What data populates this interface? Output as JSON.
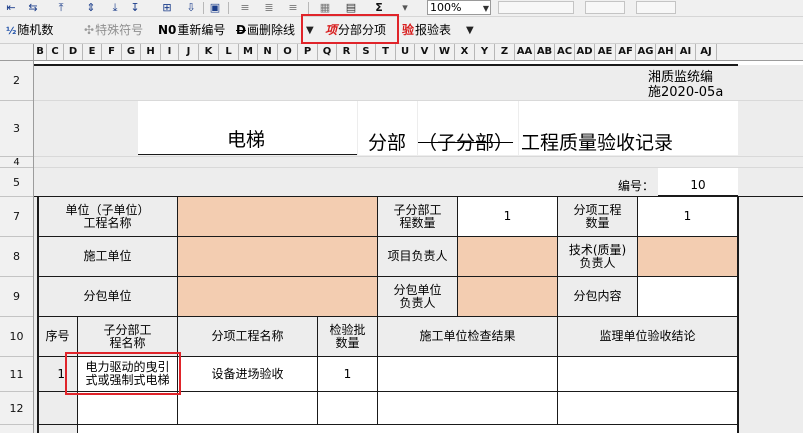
{
  "toolbar_top": {
    "zoom": "100%"
  },
  "toolbar": {
    "random_number": "随机数",
    "special_symbol": "特殊符号",
    "renumber": "重新编号",
    "delete_line": "画删除线",
    "subsection": "分部分项",
    "report_form": "报验表"
  },
  "columns": [
    "B",
    "C",
    "D",
    "E",
    "F",
    "G",
    "H",
    "I",
    "J",
    "K",
    "L",
    "M",
    "N",
    "O",
    "P",
    "Q",
    "R",
    "S",
    "T",
    "U",
    "V",
    "W",
    "X",
    "Y",
    "Z",
    "AA",
    "AB",
    "AC",
    "AD",
    "AE",
    "AF",
    "AG",
    "AH",
    "AI",
    "AJ"
  ],
  "rows": [
    "2",
    "3",
    "4",
    "5",
    "7",
    "8",
    "9",
    "10",
    "11",
    "12"
  ],
  "doc": {
    "code_line1": "湘质监统编",
    "code_line2": "施2020-05a",
    "title_main": "电梯",
    "title_mid": "分部",
    "title_struck": "（子分部）",
    "title_tail": "工程质量验收记录",
    "number_label": "编号：",
    "number_value": "10"
  },
  "info": {
    "unit_label": "单位（子单位）\n工程名称",
    "sub_count_label": "子分部工\n程数量",
    "sub_count_value": "1",
    "item_count_label": "分项工程\n数量",
    "item_count_value": "1",
    "builder_label": "施工单位",
    "project_leader_label": "项目负责人",
    "tech_leader_label": "技术(质量)\n负责人",
    "subcontractor_label": "分包单位",
    "sub_leader_label": "分包单位\n负责人",
    "sub_content_label": "分包内容"
  },
  "table": {
    "headers": [
      "序号",
      "子分部工\n程名称",
      "分项工程名称",
      "检验批\n数量",
      "施工单位检查结果",
      "监理单位验收结论"
    ],
    "rows": [
      {
        "no": "1",
        "subdivision": "电力驱动的曳引\n式或强制式电梯",
        "item": "设备进场验收",
        "count": "1",
        "check": "",
        "conclusion": ""
      }
    ]
  }
}
